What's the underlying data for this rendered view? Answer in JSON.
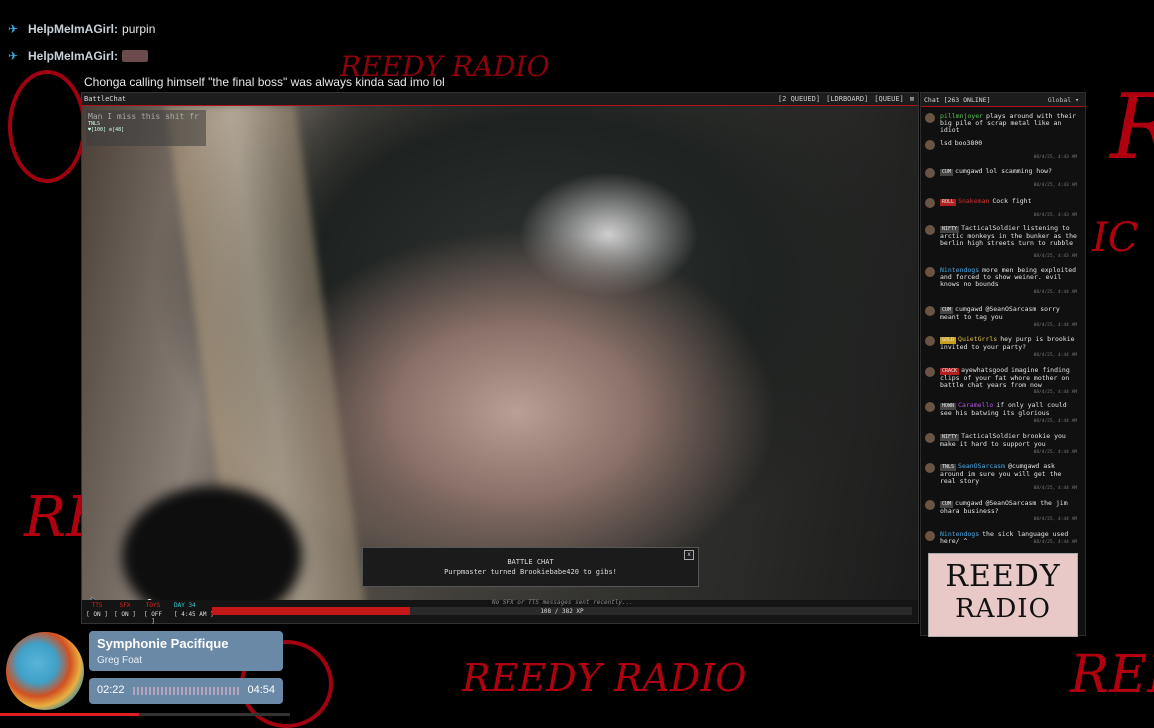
{
  "overlay_chat": [
    {
      "user": "HelpMeImAGirl:",
      "message": "purpin"
    },
    {
      "user": "HelpMeImAGirl:",
      "message": ""
    },
    {
      "user": "",
      "message": "Chonga calling himself \"the final boss\" was always kinda sad imo lol"
    }
  ],
  "window": {
    "title": "BattleChat",
    "buttons": [
      "[2 QUEUED]",
      "[LDRBOARD]",
      "[QUEUE]",
      "⊠"
    ],
    "video_overlay_text": "Man I miss this shit fr",
    "mini_panel": {
      "line1": "TNLS",
      "line2": "♥[100] ⚙[48]"
    }
  },
  "notification": {
    "title": "BATTLE CHAT",
    "message": "Purpmaster turned Brookiebabe420 to gibs!",
    "close": "x"
  },
  "volume": {
    "level": 0.9
  },
  "bottom_bar": {
    "toggles": [
      {
        "label": "TTS",
        "value": "[ ON ]"
      },
      {
        "label": "SFX",
        "value": "[ ON ]"
      },
      {
        "label": "TOYS",
        "value": "[ OFF ]"
      }
    ],
    "day": {
      "label": "DAY 34",
      "time": "[ 4:45 AM ]"
    },
    "no_sfx_text": "No SFX or TTS messages sent recently...",
    "xp_text": "108 / 382 XP",
    "xp_fraction": 0.2827
  },
  "chat_panel": {
    "header": "Chat [263 ONLINE]",
    "scope": "Global",
    "messages": [
      {
        "badge": "",
        "user": "pillmnjoyer",
        "text": "plays around with their big pile of scrap metal like an idiot",
        "color": "#58c050"
      },
      {
        "badge": "",
        "user": "lsd",
        "text": "boo3800",
        "color": "#e0e0e0"
      },
      {
        "badge": "CUM",
        "user": "cumgawd",
        "text": "lol scamming how?",
        "color": "#e0e0e0"
      },
      {
        "badge": "ROLL",
        "user": "Snakeman",
        "text": "Cock fight",
        "color": "#d03030"
      },
      {
        "badge": "NIFTY",
        "user": "TacticalSoldier",
        "text": "listening to arctic monkeys in the bunker as the berlin high streets turn to rubble",
        "color": "#e0e0e0"
      },
      {
        "badge": "",
        "user": "Nintendogs",
        "text": "more men being exploited and forced to show weiner. evil knows no bounds",
        "color": "#4aa8e8"
      },
      {
        "badge": "CUM",
        "user": "cumgawd",
        "text": "@SeanOSarcasm sorry meant to tag you",
        "color": "#e0e0e0"
      },
      {
        "badge": "GOLD",
        "user": "QuietGrrls",
        "text": "hey purp is brookie invited to your party?",
        "color": "#e0c040"
      },
      {
        "badge": "CRACK",
        "user": "ayewhatsgood",
        "text": "imagine finding clips of your fat whore mother on battle chat years from now",
        "color": "#e0e0e0"
      },
      {
        "badge": "HOWN",
        "user": "Caramello",
        "text": "if only yall could see his batwing its glorious",
        "color": "#b050e0"
      },
      {
        "badge": "NIFTY",
        "user": "TacticalSoldier",
        "text": "brookie you make it hard to support you",
        "color": "#e0e0e0"
      },
      {
        "badge": "TNLS",
        "user": "SeanOSarcasm",
        "text": "@cumgawd ask around im sure you will get the real story",
        "color": "#4aa8e8"
      },
      {
        "badge": "CUM",
        "user": "cumgawd",
        "text": "@SeanOSarcasm the jim ohara business?",
        "color": "#e0e0e0"
      },
      {
        "badge": "",
        "user": "Nintendogs",
        "text": "the sick language used here/ ^",
        "color": "#4aa8e8"
      }
    ],
    "timestamps": [
      "08/4/25, 4:43 AM",
      "08/4/25, 4:43 AM",
      "08/4/25, 4:43 AM",
      "08/4/25, 4:43 AM",
      "08/4/25, 4:44 AM",
      "08/4/25, 4:44 AM",
      "08/4/25, 4:44 AM",
      "08/4/25, 4:44 AM",
      "08/4/25, 4:44 AM",
      "08/4/25, 4:44 AM",
      "08/4/25, 4:44 AM",
      "08/4/25, 4:44 AM",
      "08/4/25, 4:44 AM"
    ]
  },
  "logo": {
    "line1": "REEDY",
    "line2": "RADIO"
  },
  "background_text": [
    "REEDY RADIO",
    "REEDY RADIO",
    "REE",
    "RE",
    "IC",
    "R"
  ],
  "music": {
    "title": "Symphonie Pacifique",
    "artist": "Greg Foat",
    "current": "02:22",
    "total": "04:54",
    "progress": 0.48
  },
  "colors": {
    "accent_red": "#b0101a",
    "music_card": "#6a89a6",
    "xp_fill": "#c41818"
  }
}
